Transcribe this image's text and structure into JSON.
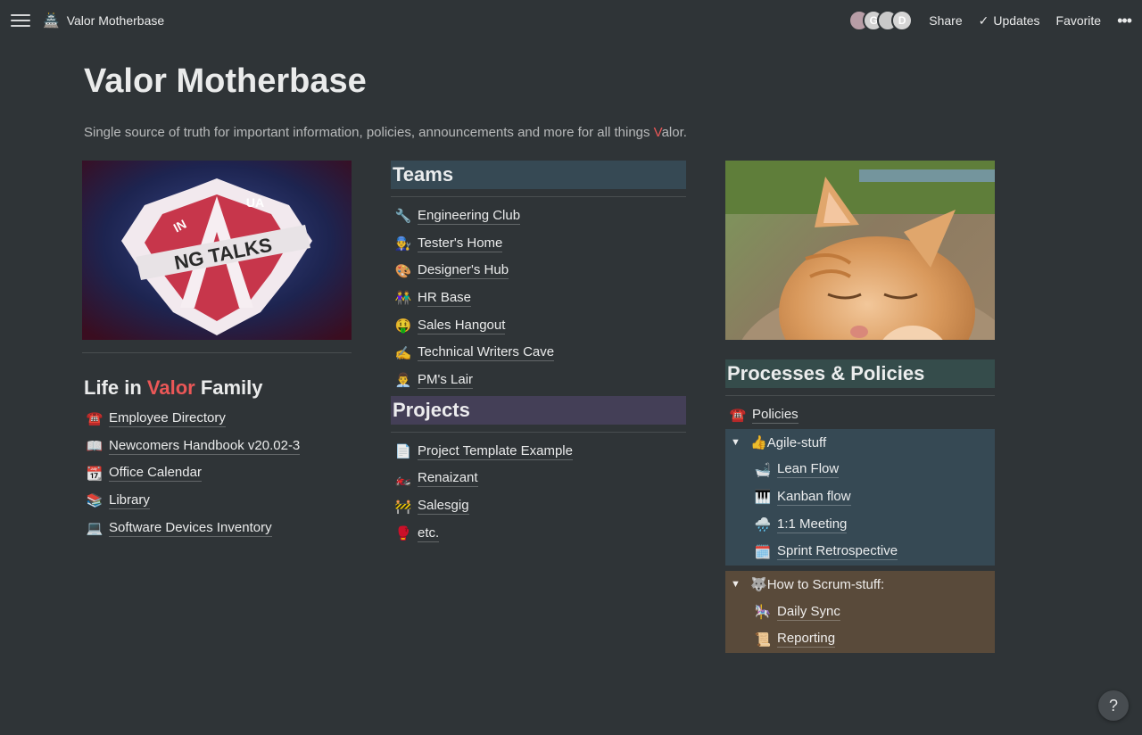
{
  "topbar": {
    "breadcrumb_icon": "pagoda-icon",
    "breadcrumb": "Valor Motherbase",
    "avatars": [
      "",
      "G",
      "",
      "D"
    ],
    "share": "Share",
    "updates": "Updates",
    "favorite": "Favorite",
    "more": "•••"
  },
  "page": {
    "title": "Valor Motherbase",
    "subtitle_pre": "Single source of truth for important information, policies, announcements and more for all things ",
    "subtitle_v": "V",
    "subtitle_post": "alor."
  },
  "col1": {
    "image_text": "NG TALKS",
    "badge_left": "IN",
    "badge_right": "UA",
    "heading_pre": "Life in ",
    "heading_accent": "Valor",
    "heading_post": " Family",
    "links": [
      {
        "icon": "☎️",
        "label": "Employee Directory"
      },
      {
        "icon": "📖",
        "label": "Newcomers Handbook v20.02-3"
      },
      {
        "icon": "📆",
        "label": "Office Calendar"
      },
      {
        "icon": "📚",
        "label": "Library"
      },
      {
        "icon": "💻",
        "label": "Software Devices Inventory"
      }
    ]
  },
  "teams": {
    "heading": "Teams",
    "links": [
      {
        "icon": "🔧",
        "label": "Engineering Club"
      },
      {
        "icon": "👨‍🔧",
        "label": "Tester's Home"
      },
      {
        "icon": "🎨",
        "label": "Designer's Hub"
      },
      {
        "icon": "👫",
        "label": "HR Base"
      },
      {
        "icon": "🤑",
        "label": "Sales Hangout"
      },
      {
        "icon": "✍️",
        "label": "Technical Writers Cave"
      },
      {
        "icon": "👨‍💼",
        "label": "PM's Lair"
      }
    ]
  },
  "projects": {
    "heading": "Projects",
    "links": [
      {
        "icon": "📄",
        "label": "Project Template Example"
      },
      {
        "icon": "🏍️",
        "label": "Renaizant"
      },
      {
        "icon": "🚧",
        "label": "Salesgig"
      },
      {
        "icon": "🥊",
        "label": "etc."
      }
    ]
  },
  "processes": {
    "heading": "Processes & Policies",
    "policies": {
      "icon": "☎️",
      "label": "Policies"
    },
    "agile": {
      "toggle": "▼",
      "icon": "👍",
      "label": "Agile-stuff",
      "items": [
        {
          "icon": "🛁",
          "label": "Lean Flow"
        },
        {
          "icon": "🎹",
          "label": "Kanban flow"
        },
        {
          "icon": "🌧️",
          "label": "1:1 Meeting"
        },
        {
          "icon": "🗓️",
          "label": "Sprint Retrospective"
        }
      ]
    },
    "scrum": {
      "toggle": "▼",
      "icon": "🐺",
      "label": "How to Scrum-stuff:",
      "items": [
        {
          "icon": "🎠",
          "label": "Daily Sync"
        },
        {
          "icon": "📜",
          "label": "Reporting"
        }
      ]
    }
  },
  "help": "?"
}
